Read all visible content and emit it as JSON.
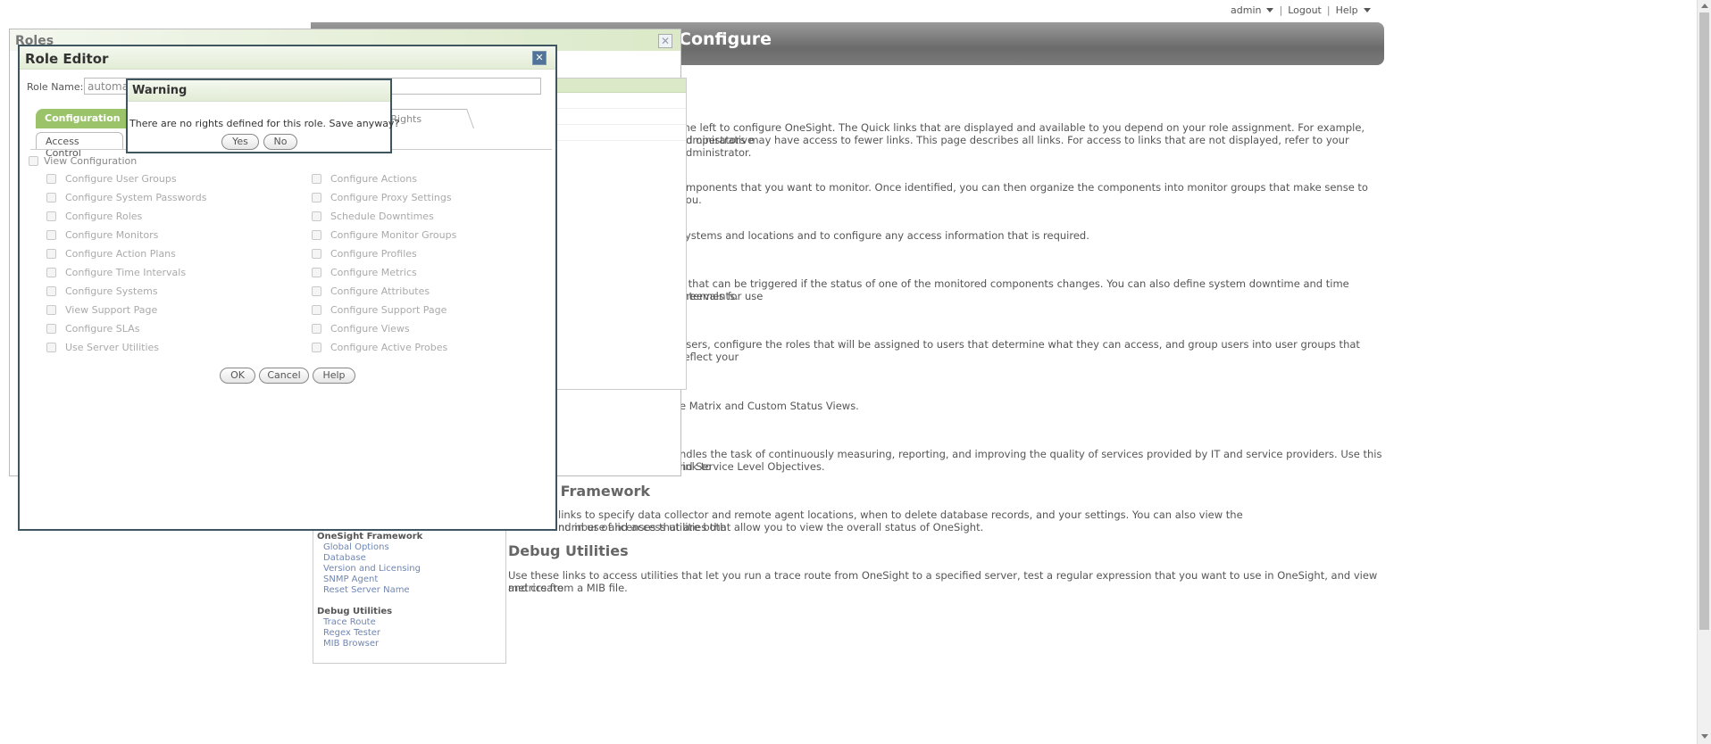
{
  "topbar": {
    "user": "admin",
    "logout": "Logout",
    "help": "Help"
  },
  "banner": {
    "title": "Configure"
  },
  "background": {
    "paragraphs": [
      "the left to configure OneSight. The Quick links that are displayed and available to you depend on your role assignment. For example, administrative",
      "nd operators may have access to fewer links. This page describes all links. For access to links that are not displayed, refer to your administrator.",
      "omponents that you want to monitor. Once identified, you can then organize the components into monitor groups that make sense to you.",
      "systems and locations and to configure any access information that is required.",
      "s that can be triggered if the status of one of the monitored components changes. You can also define system downtime and time intervals for use",
      "greements.",
      "users, configure the roles that will be assigned to users that determine what they can access, and group users into user groups that reflect your",
      "e Matrix and Custom Status Views.",
      "ndles the task of continuously measuring, reporting, and improving the quality of services provided by IT and service providers. Use this link to",
      "nd Service Level Objectives.",
      "links to specify data collector and remote agent locations, when to delete database records, and your settings. You can also view the number of licenses that are both",
      "nd in use and access utilities that allow you to view the overall status of OneSight.",
      "Use these links to access utilities that let you run a trace route from OneSight to a specified server, test a regular expression that you want to use in OneSight, and view and create",
      "metrics from a MIB file."
    ],
    "headings": [
      "ht Framework",
      "Debug Utilities"
    ]
  },
  "nav": {
    "groups": [
      {
        "label": "OneSight Framework",
        "links": [
          "Global Options",
          "Database",
          "Version and Licensing",
          "SNMP Agent",
          "Reset Server Name"
        ]
      },
      {
        "label": "Debug Utilities",
        "links": [
          "Trace Route",
          "Regex Tester",
          "MIB Browser"
        ]
      }
    ]
  },
  "roles_window": {
    "title": "Roles"
  },
  "editor": {
    "title": "Role Editor",
    "role_name_label": "Role Name:",
    "role_name_value": "automa",
    "tabs": {
      "configuration": "Configuration",
      "status_rights": "us Rights",
      "access_control": "Access Control"
    },
    "view_configuration": "View Configuration",
    "left_rights": [
      "Configure User Groups",
      "Configure System Passwords",
      "Configure Roles",
      "Configure Monitors",
      "Configure Action Plans",
      "Configure Time Intervals",
      "Configure Systems",
      "View Support Page",
      "Configure SLAs",
      "Use Server Utilities"
    ],
    "right_rights": [
      "Configure Actions",
      "Configure Proxy Settings",
      "Schedule Downtimes",
      "Configure Monitor Groups",
      "Configure Profiles",
      "Configure Metrics",
      "Configure Attributes",
      "Configure Support Page",
      "Configure Views",
      "Configure Active Probes"
    ],
    "buttons": {
      "ok": "OK",
      "cancel": "Cancel",
      "help": "Help"
    }
  },
  "warning": {
    "title": "Warning",
    "message": "There are no rights defined for this role. Save anyway?",
    "yes": "Yes",
    "no": "No"
  },
  "colors": {
    "accent_green": "#9bc46a",
    "banner_grey": "#7a7a7a",
    "dialog_border": "#3f5560"
  }
}
